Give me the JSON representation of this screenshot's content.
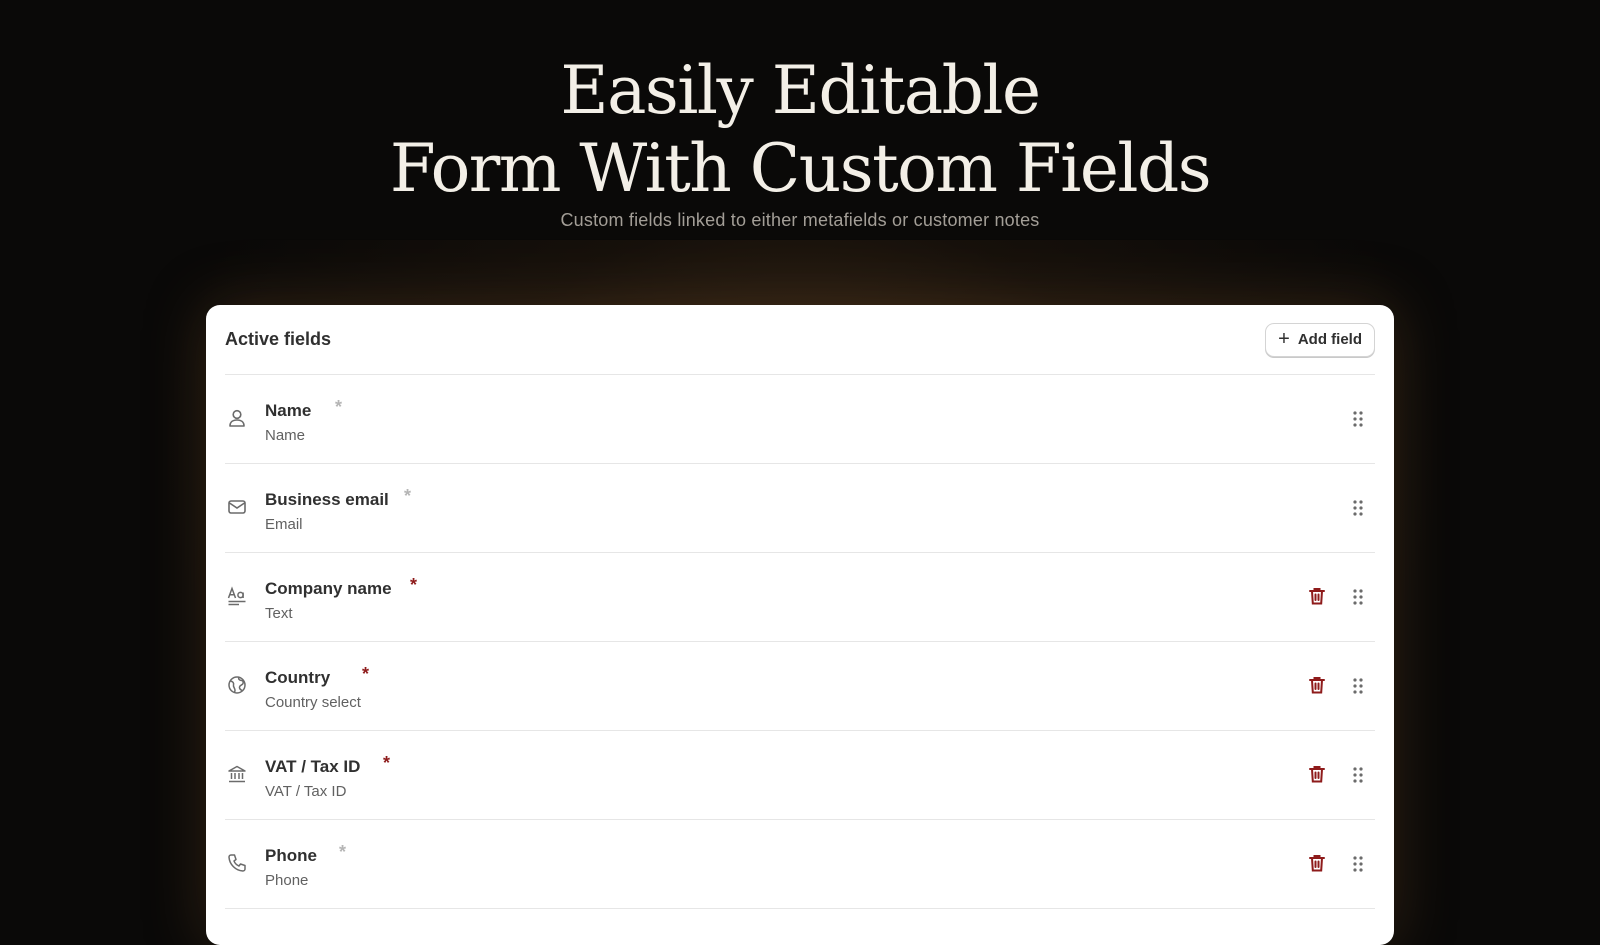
{
  "hero": {
    "title_line1": "Easily Editable",
    "title_line2": "Form With Custom Fields",
    "subtitle": "Custom fields linked to either metafields or customer notes"
  },
  "card": {
    "title": "Active fields",
    "add_button_icon": "plus-icon",
    "add_button_label": "Add field"
  },
  "colors": {
    "background": "#0a0908",
    "title_text": "#f3efe7",
    "required_red": "#8e1b1b",
    "required_grey": "#b5b5b5",
    "trash_icon": "#8e1b1b"
  },
  "fields": [
    {
      "label": "Name",
      "type": "Name",
      "icon": "person-icon",
      "required_marker": "*",
      "required_style": "grey",
      "deletable": false
    },
    {
      "label": "Business email",
      "type": "Email",
      "icon": "envelope-icon",
      "required_marker": "*",
      "required_style": "grey",
      "deletable": false
    },
    {
      "label": "Company name",
      "type": "Text",
      "icon": "text-format-icon",
      "required_marker": "*",
      "required_style": "red",
      "deletable": true
    },
    {
      "label": "Country",
      "type": "Country select",
      "icon": "globe-icon",
      "required_marker": "*",
      "required_style": "red",
      "deletable": true
    },
    {
      "label": "VAT / Tax ID",
      "type": "VAT / Tax ID",
      "icon": "bank-icon",
      "required_marker": "*",
      "required_style": "red",
      "deletable": true
    },
    {
      "label": "Phone",
      "type": "Phone",
      "icon": "phone-icon",
      "required_marker": "*",
      "required_style": "grey",
      "deletable": true
    }
  ]
}
